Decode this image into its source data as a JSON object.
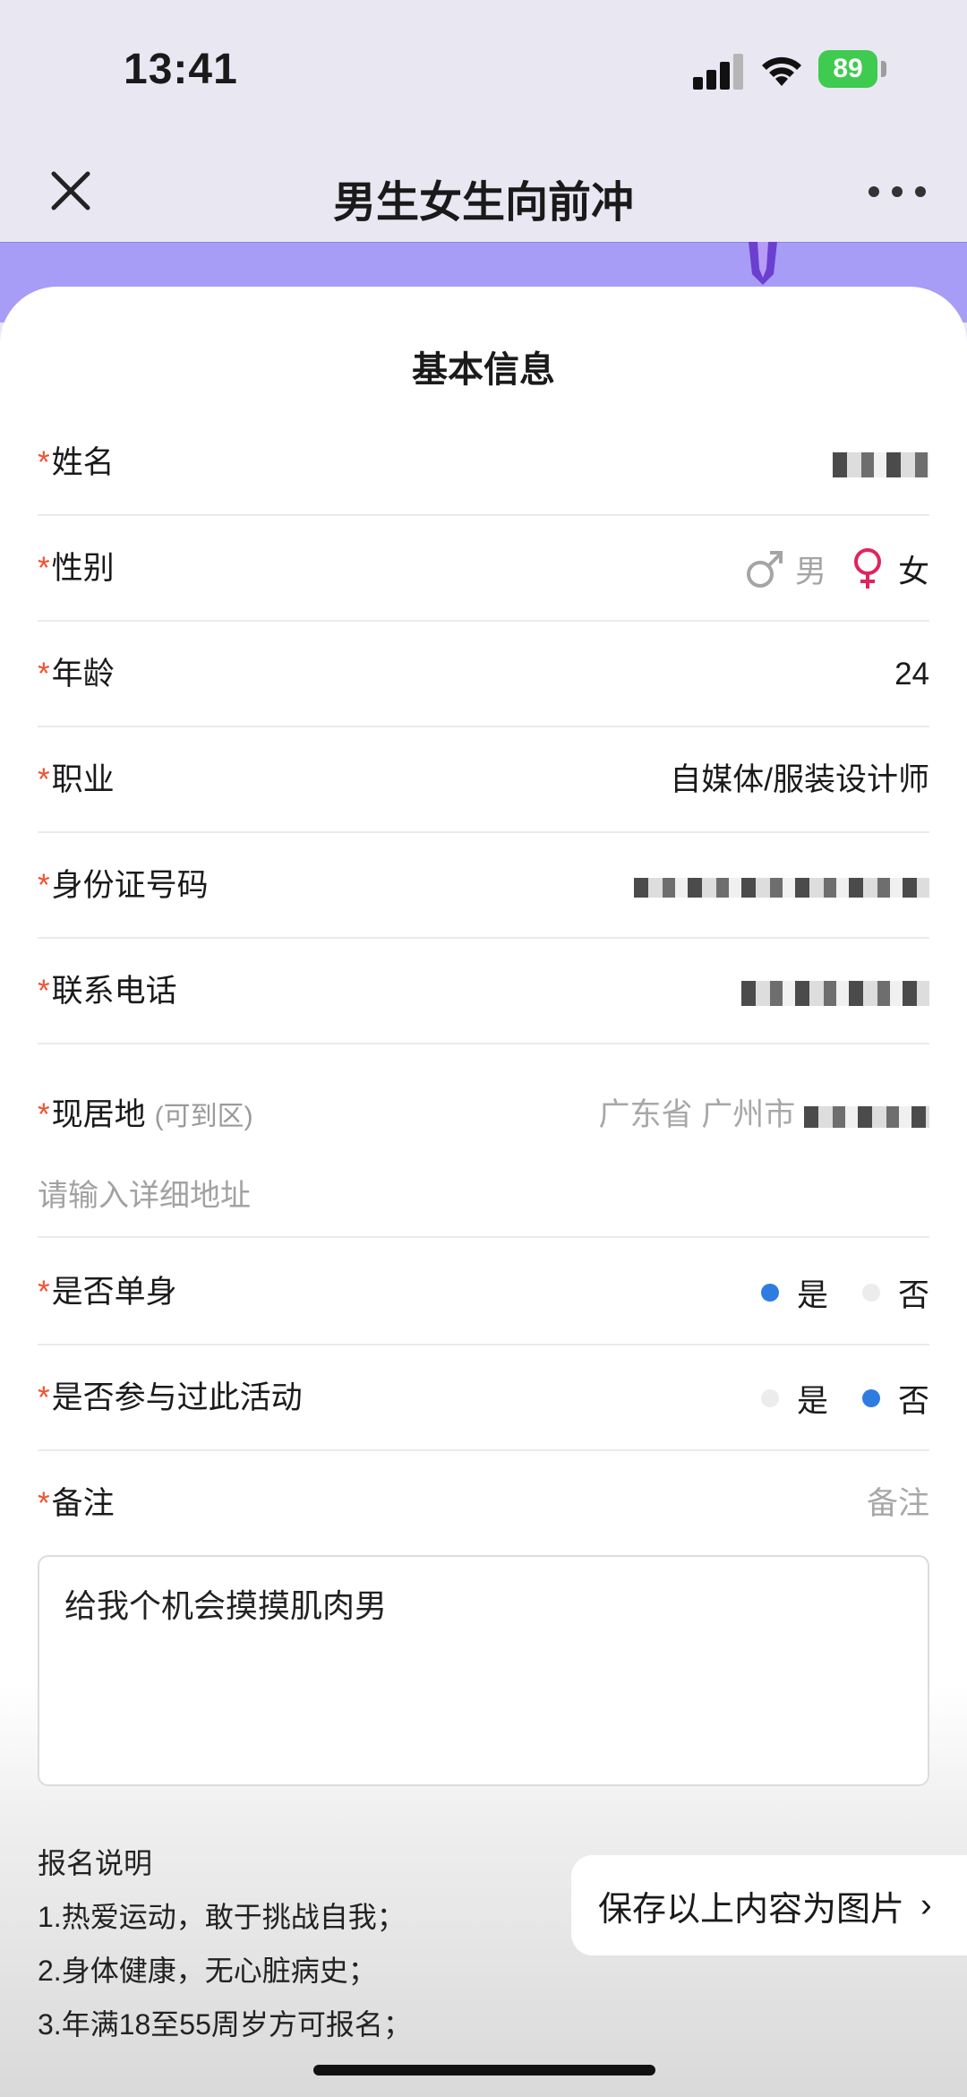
{
  "status": {
    "time": "13:41",
    "battery": "89"
  },
  "nav": {
    "title": "男生女生向前冲"
  },
  "form": {
    "title": "基本信息",
    "required_mark": "*",
    "name": {
      "label": "姓名"
    },
    "gender": {
      "label": "性别",
      "male": "男",
      "female": "女",
      "selected": "女"
    },
    "age": {
      "label": "年龄",
      "value": "24"
    },
    "job": {
      "label": "职业",
      "value": "自媒体/服装设计师"
    },
    "id_number": {
      "label": "身份证号码"
    },
    "phone": {
      "label": "联系电话"
    },
    "address": {
      "label": "现居地",
      "hint": "(可到区)",
      "region": "广东省 广州市",
      "placeholder": "请输入详细地址"
    },
    "single": {
      "label": "是否单身",
      "yes": "是",
      "no": "否",
      "selected": "是"
    },
    "joined_before": {
      "label": "是否参与过此活动",
      "yes": "是",
      "no": "否",
      "selected": "否"
    },
    "remark": {
      "label": "备注",
      "placeholder": "备注",
      "text": "给我个机会摸摸肌肉男"
    }
  },
  "notes": {
    "title": "报名说明",
    "items": [
      "1.热爱运动，敢于挑战自我；",
      "2.身体健康，无心脏病史；",
      "3.年满18至55周岁方可报名；"
    ]
  },
  "save_button": {
    "label": "保存以上内容为图片",
    "chevron": "›"
  },
  "colors": {
    "accent": "#2f7ce0",
    "required": "#f0532f",
    "female": "#e0245e",
    "banner": "#a79df6"
  }
}
